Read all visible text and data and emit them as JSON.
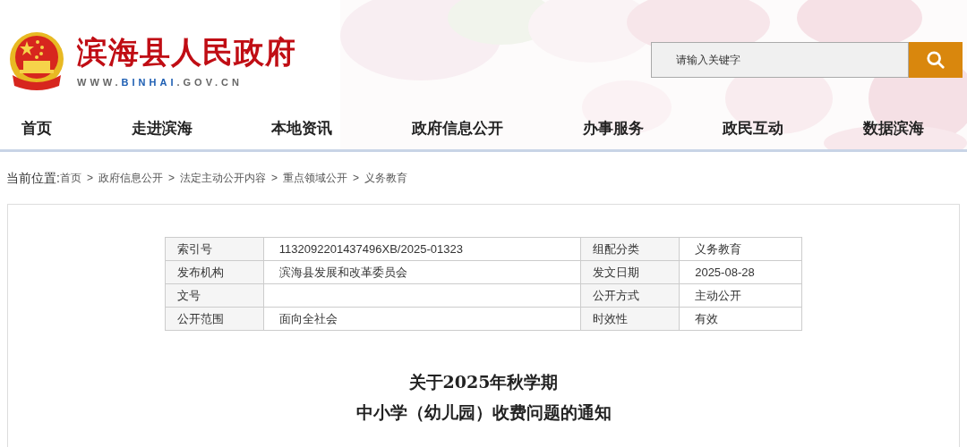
{
  "header": {
    "site_title": "滨海县人民政府",
    "site_url": [
      {
        "text": "WWW.",
        "highlight": false
      },
      {
        "text": "BINHAI",
        "highlight": true
      },
      {
        "text": ".GOV.CN",
        "highlight": false
      }
    ],
    "search": {
      "placeholder": "请输入关键字"
    }
  },
  "nav": [
    {
      "label": "首页"
    },
    {
      "label": "走进滨海"
    },
    {
      "label": "本地资讯"
    },
    {
      "label": "政府信息公开"
    },
    {
      "label": "办事服务"
    },
    {
      "label": "政民互动"
    },
    {
      "label": "数据滨海"
    }
  ],
  "breadcrumb": {
    "label": "当前位置:",
    "items": [
      {
        "text": "首页",
        "separator": ">"
      },
      {
        "text": "政府信息公开",
        "separator": ">"
      },
      {
        "text": "法定主动公开内容",
        "separator": ">"
      },
      {
        "text": "重点领域公开",
        "separator": ">"
      },
      {
        "text": "义务教育"
      }
    ]
  },
  "info_table": {
    "rows": [
      {
        "cells": [
          "索引号",
          "1132092201437496XB/2025-01323",
          "组配分类",
          "义务教育"
        ]
      },
      {
        "cells": [
          "发布机构",
          "滨海县发展和改革委员会",
          "发文日期",
          "2025-08-28"
        ]
      },
      {
        "cells": [
          "文号",
          "",
          "公开方式",
          "主动公开"
        ]
      },
      {
        "cells": [
          "公开范围",
          "面向全社会",
          "时效性",
          "有效"
        ]
      }
    ]
  },
  "article": {
    "title_lines": [
      "关于2025年秋学期",
      "中小学（幼儿园）收费问题的通知"
    ]
  }
}
